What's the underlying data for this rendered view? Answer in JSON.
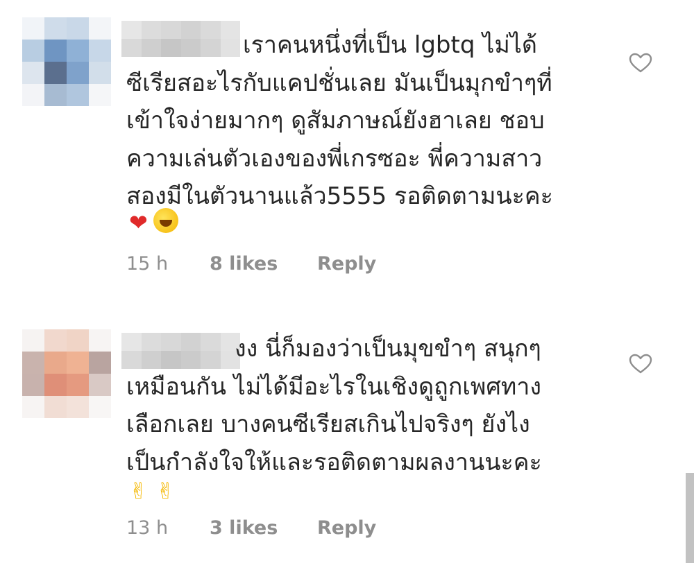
{
  "comments": [
    {
      "text_first": "เราคนหนึ่งที่เป็น lgbtq ไม่ได้",
      "text_rest": "ซีเรียสอะไรกับแคปชั่นเลย มันเป็นมุกขำๆที่\nเข้าใจง่ายมากๆ ดูสัมภาษณ์ยังฮาเลย ชอบ\nความเล่นตัวเองของพี่เกรซอะ พี่ความสาว\nสองมีในตัวนานแล้ว5555 รอติดตามนะคะ",
      "emoji": "❤",
      "time": "15 h",
      "likes": "8 likes",
      "reply": "Reply",
      "avatar_colors": [
        "#f1f4f8",
        "#cfdcea",
        "#c9d8e8",
        "#f3f5f8",
        "#b8cde2",
        "#6f95c2",
        "#8fb1d6",
        "#c7d7e8",
        "#dde5ee",
        "#5b6f8e",
        "#7fa2cb",
        "#d2deea",
        "#f3f4f7",
        "#a7bbd2",
        "#b0c6de",
        "#f5f6f8"
      ]
    },
    {
      "text_first": "งง นี่ก็มองว่าเป็นมุขขำๆ สนุกๆ",
      "text_rest": "เหมือนกัน ไม่ได้มีอะไรในเชิงดูถูกเพศทาง\nเลือกเลย บางคนซีเรียสเกินไปจริงๆ ยังไง\nเป็นกำลังใจให้และรอติดตามผลงานนะคะ",
      "emoji": "✌",
      "time": "13 h",
      "likes": "3 likes",
      "reply": "Reply",
      "avatar_colors": [
        "#f6f3f2",
        "#f1d8cd",
        "#f0d4c6",
        "#f7f4f3",
        "#c9b3ad",
        "#e9a98b",
        "#efb293",
        "#b9a4a0",
        "#c8b2ad",
        "#df8f78",
        "#e59a80",
        "#d9c9c5",
        "#f7f4f3",
        "#f1ddd4",
        "#f3e2da",
        "#f8f6f5"
      ]
    }
  ],
  "username_colors": [
    [
      "#e6e6e6",
      "#dcdcdc",
      "#d8d8d8",
      "#d2d2d2",
      "#dadada",
      "#e4e4e4"
    ],
    [
      "#d9d9d9",
      "#cfcfcf",
      "#c6c6c6",
      "#cbcbcb",
      "#d4d4d4",
      "#e2e2e2"
    ]
  ],
  "icons": {
    "like": "heart-outline-icon"
  }
}
